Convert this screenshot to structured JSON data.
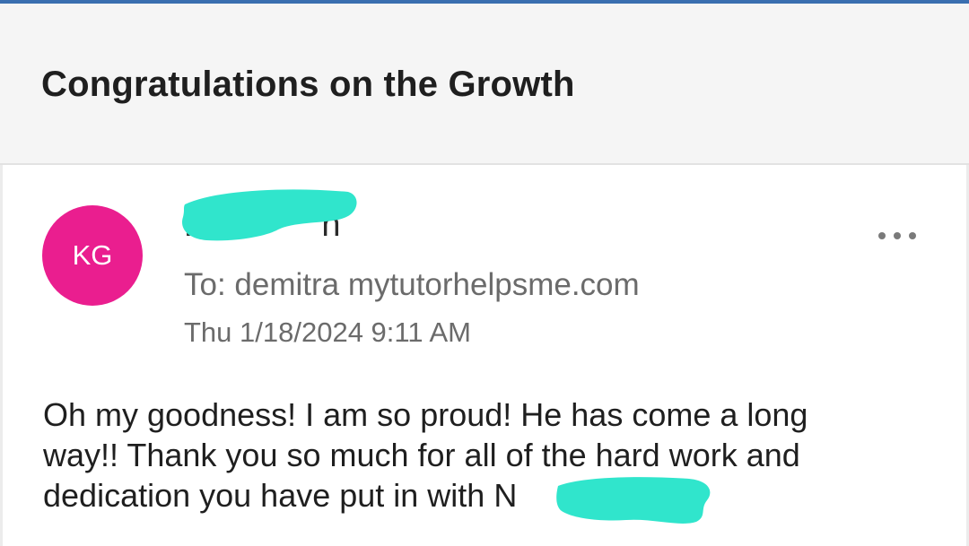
{
  "email": {
    "subject": "Congratulations on the Growth",
    "avatar_initials": "KG",
    "sender_visible_start": "K",
    "sender_visible_end": "n",
    "to_line": "To: demitra mytutorhelpsme.com",
    "date_line": "Thu 1/18/2024 9:11 AM",
    "body_lines": [
      "Oh my goodness! I am so proud! He has come a long",
      "way!! Thank you so much for all of the hard work and",
      "dedication you have put in with N"
    ]
  },
  "colors": {
    "avatar_bg": "#ea1e8f",
    "redaction": "#30e5cc",
    "topline": "#3a6fb0"
  },
  "icons": {
    "more_options": "more-horizontal-icon"
  }
}
